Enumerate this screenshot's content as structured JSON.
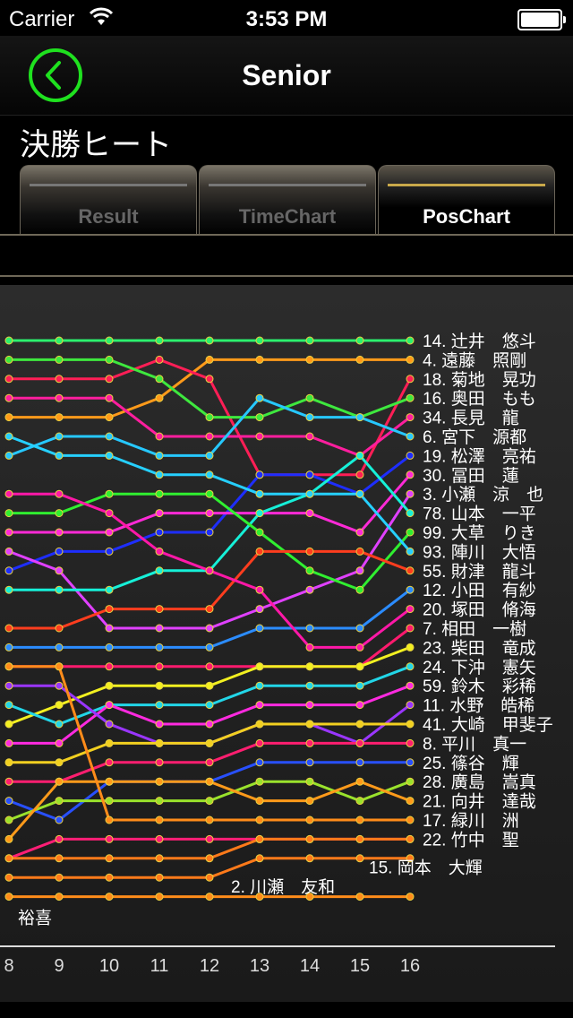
{
  "status": {
    "carrier": "Carrier",
    "time": "3:53 PM"
  },
  "nav": {
    "title": "Senior"
  },
  "heat_title": "決勝ヒート",
  "tabs": [
    "Result",
    "TimeChart",
    "PosChart"
  ],
  "active_tab": "PosChart",
  "colors": {
    "back": "#1fe11f",
    "tab_active_line": "#c9a94a"
  },
  "chart_data": {
    "type": "line",
    "x": [
      8,
      9,
      10,
      11,
      12,
      13,
      14,
      15,
      16
    ],
    "x_ticks": [
      "8",
      "9",
      "10",
      "11",
      "12",
      "13",
      "14",
      "15",
      "16"
    ],
    "y_range": [
      1,
      28
    ],
    "y_inverted": true,
    "series": [
      {
        "label": "14. 辻井　悠斗",
        "color": "#2cf06e",
        "positions": [
          1,
          1,
          1,
          1,
          1,
          1,
          1,
          1,
          1
        ]
      },
      {
        "label": "4. 遠藤　照剛",
        "color": "#ff9a1a",
        "positions": [
          5,
          5,
          5,
          4,
          2,
          2,
          2,
          2,
          2
        ]
      },
      {
        "label": "18. 菊地　晃功",
        "color": "#ff1e56",
        "positions": [
          3,
          3,
          3,
          2,
          3,
          8,
          8,
          8,
          3
        ]
      },
      {
        "label": "16. 奥田　もも",
        "color": "#3ee83e",
        "positions": [
          2,
          2,
          2,
          3,
          5,
          5,
          4,
          5,
          4
        ]
      },
      {
        "label": "34. 長見　龍",
        "color": "#ff1e9e",
        "positions": [
          4,
          4,
          4,
          6,
          6,
          6,
          6,
          7,
          5
        ]
      },
      {
        "label": "6. 宮下　源都",
        "color": "#26c8ff",
        "positions": [
          7,
          6,
          6,
          7,
          7,
          4,
          5,
          5,
          6
        ]
      },
      {
        "label": "19. 松澤　亮祐",
        "color": "#1e2eff",
        "positions": [
          13,
          12,
          12,
          11,
          11,
          8,
          8,
          9,
          7
        ]
      },
      {
        "label": "30. 冨田　蓮",
        "color": "#ff2ad7",
        "positions": [
          11,
          11,
          11,
          10,
          10,
          10,
          10,
          11,
          8
        ]
      },
      {
        "label": "3. 小瀬　涼　也",
        "color": "#e040ff",
        "positions": [
          12,
          13,
          16,
          16,
          16,
          15,
          14,
          13,
          9
        ]
      },
      {
        "label": "78. 山本　一平",
        "color": "#16f0d8",
        "positions": [
          14,
          14,
          14,
          13,
          13,
          10,
          9,
          7,
          10
        ]
      },
      {
        "label": "99. 大草　りき",
        "color": "#30ef30",
        "positions": [
          10,
          10,
          9,
          9,
          9,
          11,
          13,
          14,
          11
        ]
      },
      {
        "label": "93. 陣川　大悟",
        "color": "#26d0ff",
        "positions": [
          6,
          7,
          7,
          8,
          8,
          9,
          9,
          9,
          12
        ]
      },
      {
        "label": "55. 財津　龍斗",
        "color": "#ff3d1e",
        "positions": [
          16,
          16,
          15,
          15,
          15,
          12,
          12,
          12,
          13
        ]
      },
      {
        "label": "12. 小田　有紗",
        "color": "#2b8cff",
        "positions": [
          17,
          17,
          17,
          17,
          17,
          16,
          16,
          16,
          14
        ]
      },
      {
        "label": "20. 塚田　脩海",
        "color": "#ff18a8",
        "positions": [
          9,
          9,
          10,
          12,
          13,
          14,
          17,
          17,
          15
        ]
      },
      {
        "label": "7. 相田　一樹",
        "color": "#ff1a6e",
        "positions": [
          18,
          18,
          18,
          18,
          18,
          18,
          18,
          18,
          16
        ]
      },
      {
        "label": "23. 柴田　竜成",
        "color": "#f2f020",
        "positions": [
          21,
          20,
          19,
          19,
          19,
          18,
          18,
          18,
          17
        ]
      },
      {
        "label": "24. 下沖　憲矢",
        "color": "#22d6e8",
        "positions": [
          20,
          21,
          20,
          20,
          20,
          19,
          19,
          19,
          18
        ]
      },
      {
        "label": "59. 鈴木　彩稀",
        "color": "#ff2ae0",
        "positions": [
          22,
          22,
          20,
          21,
          21,
          20,
          20,
          20,
          19
        ]
      },
      {
        "label": "11. 水野　皓稀",
        "color": "#9a36ff",
        "positions": [
          19,
          19,
          21,
          22,
          22,
          21,
          21,
          22,
          20
        ]
      },
      {
        "label": "41. 大崎　甲斐子",
        "color": "#f2d020",
        "positions": [
          23,
          23,
          22,
          22,
          22,
          21,
          21,
          21,
          21
        ]
      },
      {
        "label": "8. 平川　真一",
        "color": "#ff1e70",
        "positions": [
          24,
          24,
          23,
          23,
          23,
          22,
          22,
          22,
          22
        ]
      },
      {
        "label": "25. 篠谷　輝",
        "color": "#2850ff",
        "positions": [
          25,
          26,
          24,
          24,
          24,
          23,
          23,
          23,
          23
        ]
      },
      {
        "label": "28. 廣島　嵩真",
        "color": "#9ae22c",
        "positions": [
          26,
          25,
          25,
          25,
          25,
          24,
          24,
          25,
          24
        ]
      },
      {
        "label": "21. 向井　達哉",
        "color": "#ff9a1a",
        "positions": [
          27,
          24,
          24,
          24,
          24,
          25,
          25,
          24,
          25
        ]
      },
      {
        "label": "17. 緑川　洲",
        "color": "#ff8c1a",
        "positions": [
          18,
          18,
          26,
          26,
          26,
          26,
          26,
          26,
          26
        ]
      },
      {
        "label": "22. 竹中　聖",
        "color": "#ff1e76",
        "positions": [
          28,
          27,
          27,
          27,
          27,
          27,
          27,
          27,
          27
        ]
      },
      {
        "label": "15. 岡本　大輝",
        "color": "#ff7a1a",
        "positions": [
          28,
          28,
          28,
          28,
          28,
          27,
          27,
          27,
          27
        ]
      },
      {
        "label": "2. 川瀬　友和",
        "color": "#ff7a1a",
        "positions": [
          29,
          29,
          29,
          29,
          29,
          28,
          28,
          28,
          28
        ]
      },
      {
        "label": "裕喜",
        "color": "#ff8c1a",
        "positions": [
          30,
          30,
          30,
          30,
          30,
          30,
          30,
          30,
          30
        ]
      }
    ]
  }
}
